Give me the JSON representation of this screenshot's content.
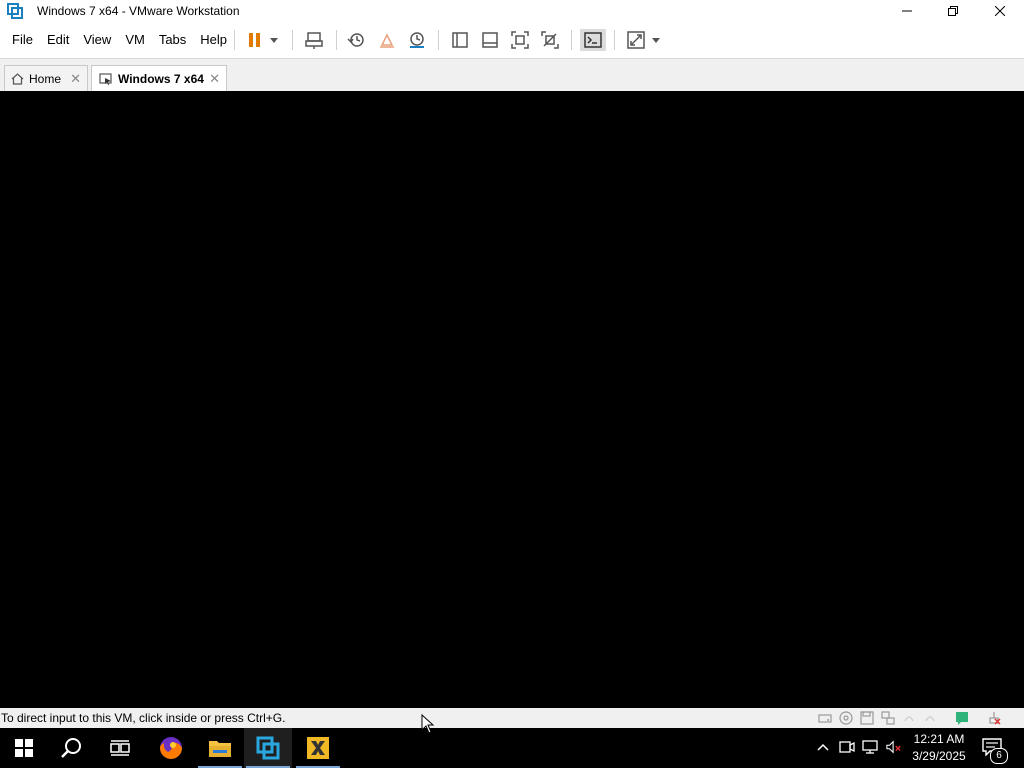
{
  "window": {
    "title": "Windows 7 x64 - VMware Workstation"
  },
  "menu": {
    "items": [
      "File",
      "Edit",
      "View",
      "VM",
      "Tabs",
      "Help"
    ]
  },
  "toolbar": {
    "icons": [
      "pause-icon",
      "dropdown-arrow-icon",
      "send-ctrl-alt-del-icon",
      "snapshot-icon",
      "revert-snapshot-icon",
      "snapshot-manager-icon",
      "show-library-icon",
      "thumbnail-bar-icon",
      "full-screen-icon",
      "unity-icon",
      "console-view-icon",
      "stretch-guest-icon",
      "dropdown-arrow-icon"
    ]
  },
  "tabs": [
    {
      "label": "Home",
      "icon": "home-icon",
      "active": false
    },
    {
      "label": "Windows 7 x64",
      "icon": "vm-icon",
      "active": true
    }
  ],
  "status": {
    "message": "To direct input to this VM, click inside or press Ctrl+G."
  },
  "taskbar": {
    "apps": [
      "start-icon",
      "search-icon",
      "task-view-icon",
      "firefox-icon",
      "file-explorer-icon",
      "vmware-workstation-icon",
      "vmware-player-icon"
    ],
    "clock": {
      "time": "12:21 AM",
      "date": "3/29/2025"
    },
    "notification_count": "6"
  },
  "colors": {
    "accent": "#e07b00",
    "vm_background": "#000000",
    "taskbar_background": "#000000"
  }
}
